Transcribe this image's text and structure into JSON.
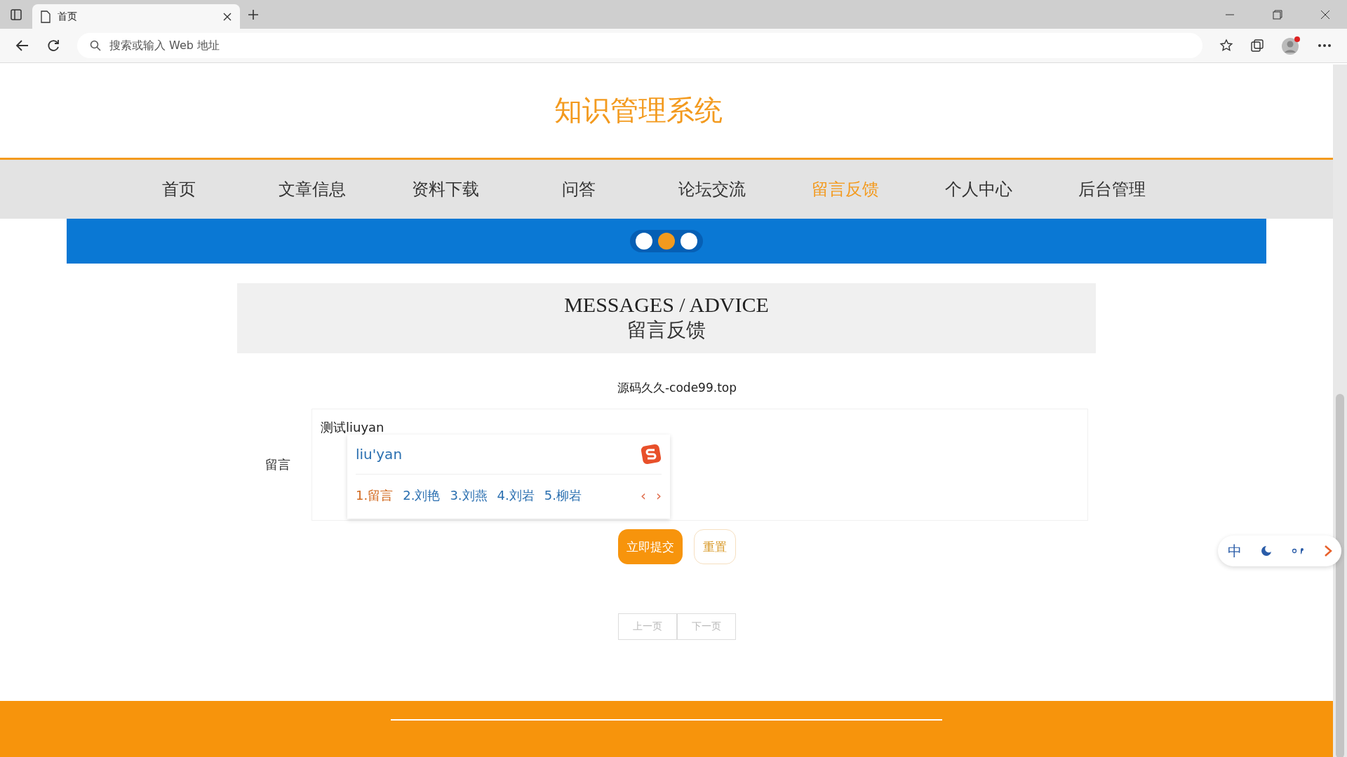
{
  "browser": {
    "tab_title": "首页",
    "address_placeholder": "搜索或输入 Web 地址"
  },
  "site_title": "知识管理系统",
  "nav": [
    {
      "label": "首页",
      "selected": false
    },
    {
      "label": "文章信息",
      "selected": false
    },
    {
      "label": "资料下载",
      "selected": false
    },
    {
      "label": "问答",
      "selected": false
    },
    {
      "label": "论坛交流",
      "selected": false
    },
    {
      "label": "留言反馈",
      "selected": true
    },
    {
      "label": "个人中心",
      "selected": false
    },
    {
      "label": "后台管理",
      "selected": false
    }
  ],
  "banner_dots": [
    {
      "selected": false
    },
    {
      "selected": true
    },
    {
      "selected": false
    }
  ],
  "section": {
    "title_en": "MESSAGES / ADVICE",
    "title_zh": "留言反馈"
  },
  "source_note": "源码久久-code99.top",
  "form": {
    "label": "留言",
    "value": "测试liuyan",
    "submit": "立即提交",
    "reset": "重置"
  },
  "ime": {
    "composition": "liu'yan",
    "candidates": [
      {
        "text": "1.留言",
        "selected": true
      },
      {
        "text": "2.刘艳",
        "selected": false
      },
      {
        "text": "3.刘燕",
        "selected": false
      },
      {
        "text": "4.刘岩",
        "selected": false
      },
      {
        "text": "5.柳岩",
        "selected": false
      }
    ],
    "prev": "‹",
    "next": "›"
  },
  "pagination": {
    "prev": "上一页",
    "next": "下一页"
  },
  "ime_toolbar": {
    "mode": "中"
  }
}
